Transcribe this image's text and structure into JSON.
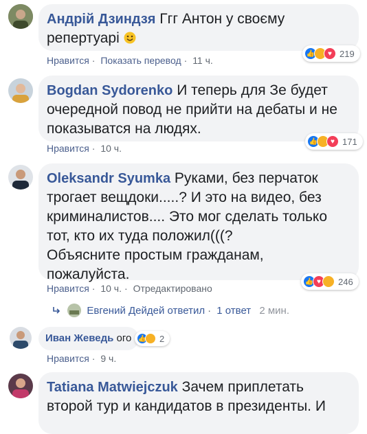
{
  "comments": [
    {
      "author": "Андрій Дзиндзя",
      "text_line1": " Ггг Антон у своєму",
      "text_line2": "репертуарі",
      "emoji": "smile",
      "actions": {
        "like": "Нравится",
        "translate": "Показать перевод",
        "time": "11 ч."
      },
      "reactions": {
        "icons": [
          "like",
          "haha",
          "love"
        ],
        "count": "219"
      }
    },
    {
      "author": "Bogdan Sydorenko",
      "text_line1": " И теперь для Зе будет",
      "text_line2": "очередной повод не прийти на дебаты и не",
      "text_line3": "показыватся на людях.",
      "actions": {
        "like": "Нравится",
        "time": "10 ч."
      },
      "reactions": {
        "icons": [
          "like",
          "haha",
          "love"
        ],
        "count": "171"
      }
    },
    {
      "author": "Oleksandr Syumka",
      "text_line1": " Руками, без перчаток",
      "text_line2": "трогает вещдоки.....? И это на видео, без",
      "text_line3": "криминалистов.... Это мог сделать только",
      "text_line4": "тот, кто их туда положил(((?",
      "text_line5": "Объясните простым гражданам,",
      "text_line6": "пожалуйста.",
      "actions": {
        "like": "Нравится",
        "time": "10 ч.",
        "edited": "Отредактировано"
      },
      "reactions": {
        "icons": [
          "like",
          "love",
          "wow"
        ],
        "count": "246"
      },
      "reply_summary": {
        "name": "Евгений Дейдей",
        "verb": "ответил",
        "count": "1 ответ",
        "time": "2 мин."
      }
    },
    {
      "author": "Иван Жеведь",
      "text_line1": " ого",
      "actions": {
        "like": "Нравится",
        "time": "9 ч."
      },
      "reactions": {
        "icons": [
          "like",
          "haha"
        ],
        "count": "2"
      }
    },
    {
      "author": "Tatiana Matwiejczuk",
      "text_line1": " Зачем приплетать",
      "text_line2": "второй тур и кандидатов в президенты. И"
    }
  ],
  "colors": {
    "link": "#385898",
    "bubble": "#f2f3f5",
    "like": "#1877f2",
    "love": "#f33e58",
    "haha": "#f7b125"
  }
}
